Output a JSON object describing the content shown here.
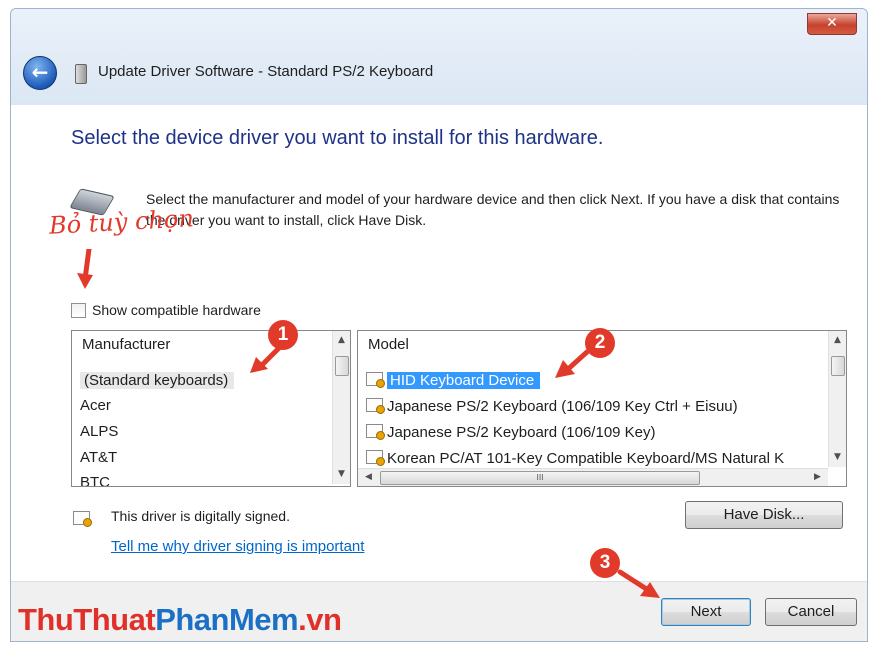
{
  "window": {
    "title": "Update Driver Software - Standard PS/2 Keyboard",
    "close_glyph": "✕",
    "back_glyph": "←"
  },
  "heading": "Select the device driver you want to install for this hardware.",
  "description": "Select the manufacturer and model of your hardware device and then click Next. If you have a disk that contains the driver you want to install, click Have Disk.",
  "annotation": {
    "text": "Bỏ tuỳ chọn",
    "badges": [
      "1",
      "2",
      "3"
    ],
    "color": "#e23a2a"
  },
  "show_compatible": {
    "label": "Show compatible hardware",
    "checked": false
  },
  "manufacturer_list": {
    "header": "Manufacturer",
    "items": [
      "(Standard keyboards)",
      "Acer",
      "ALPS",
      "AT&T",
      "BTC"
    ],
    "selected_index": 0
  },
  "model_list": {
    "header": "Model",
    "items": [
      "HID Keyboard Device",
      "Japanese PS/2 Keyboard (106/109 Key Ctrl + Eisuu)",
      "Japanese PS/2 Keyboard (106/109 Key)",
      "Korean PC/AT 101-Key Compatible Keyboard/MS Natural K"
    ],
    "selected_index": 0,
    "item_icon": "certificate-icon",
    "hscroll_thumb_glyph": "III"
  },
  "signed": {
    "text": "This driver is digitally signed.",
    "icon": "certificate-icon"
  },
  "signing_link": "Tell me why driver signing is important",
  "buttons": {
    "have_disk": "Have Disk...",
    "next": "Next",
    "cancel": "Cancel"
  },
  "scroll_glyphs": {
    "up": "▲",
    "down": "▼",
    "left": "◀",
    "right": "▶"
  },
  "watermark": {
    "part1": "ThuThuat",
    "part2": "PhanMem",
    "part3": ".vn"
  },
  "colors": {
    "heading": "#1e3287",
    "selection": "#3399ff",
    "link": "#0066cc",
    "annotation": "#e23a2a"
  }
}
